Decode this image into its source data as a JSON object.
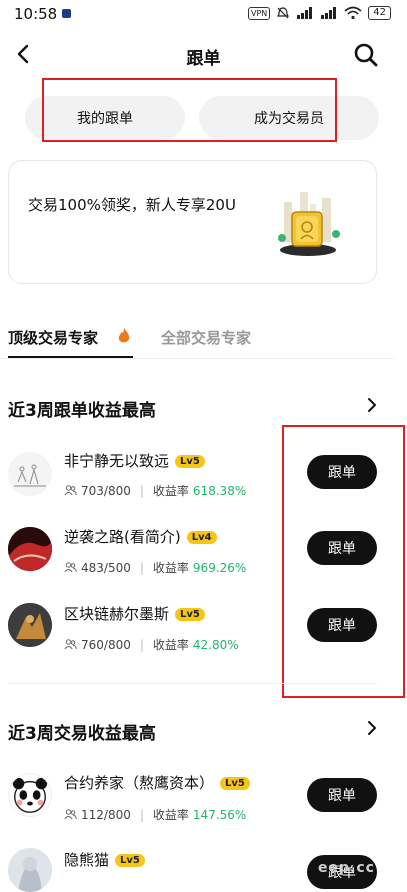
{
  "status_bar": {
    "time": "10:58",
    "vpn": "VPN",
    "battery": "42"
  },
  "header": {
    "title": "跟单"
  },
  "pills": {
    "my_follow": "我的跟单",
    "become_trader": "成为交易员"
  },
  "banner": {
    "text": "交易100%领奖，新人专享20U"
  },
  "tabs": {
    "top_experts": "顶级交易专家",
    "all_experts": "全部交易专家"
  },
  "section1": {
    "title": "近3周跟单收益最高",
    "rows": [
      {
        "name": "非宁静无以致远",
        "level": "Lv5",
        "count": "703/800",
        "rate_label": "收益率",
        "rate": "618.38%",
        "button": "跟单"
      },
      {
        "name": "逆袭之路(看简介)",
        "level": "Lv4",
        "count": "483/500",
        "rate_label": "收益率",
        "rate": "969.26%",
        "button": "跟单"
      },
      {
        "name": "区块链赫尔墨斯",
        "level": "Lv5",
        "count": "760/800",
        "rate_label": "收益率",
        "rate": "42.80%",
        "button": "跟单"
      }
    ]
  },
  "section2": {
    "title": "近3周交易收益最高",
    "rows": [
      {
        "name": "合约养家（熬鹰资本）",
        "level": "Lv5",
        "count": "112/800",
        "rate_label": "收益率",
        "rate": "147.56%",
        "button": "跟单"
      },
      {
        "name": "隐熊猫",
        "level": "Lv5",
        "button": "跟单"
      }
    ]
  },
  "watermark": "eep.cc",
  "colors": {
    "accent_green": "#21b36b",
    "level_badge": "#f5c518",
    "highlight_red": "#e02020"
  }
}
